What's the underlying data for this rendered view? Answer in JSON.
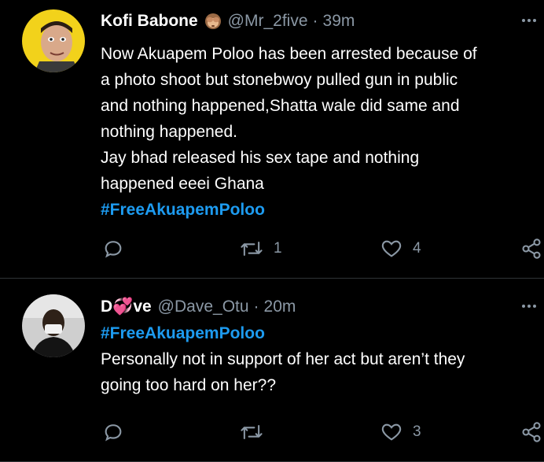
{
  "tweets": [
    {
      "author_name": "Kofi Babone",
      "author_emoji": "see-no-evil-monkey",
      "handle": "@Mr_2five",
      "separator": "·",
      "time": "39m",
      "lines": [
        "Now Akuapem Poloo has been arrested because of",
        "a photo shoot  but stonebwoy pulled gun in public",
        "and nothing happened,Shatta wale did same and",
        "nothing happened.",
        "Jay bhad released his sex tape and nothing",
        "happened eeei Ghana"
      ],
      "hashtag": "#FreeAkuapemPoloo",
      "retweets": "1",
      "likes": "4"
    },
    {
      "author_name": "D💞ve",
      "handle": "@Dave_Otu",
      "separator": "·",
      "time": "20m",
      "hashtag": "#FreeAkuapemPoloo",
      "lines": [
        "Personally not in support of her act but aren’t they",
        "going too hard on her??"
      ],
      "retweets": "",
      "likes": "3"
    }
  ],
  "icons": {
    "reply": "reply-icon",
    "retweet": "retweet-icon",
    "like": "heart-icon",
    "share": "share-icon",
    "more": "more-icon"
  },
  "colors": {
    "background": "#000000",
    "text": "#ffffff",
    "muted": "#8b98a5",
    "hashtag": "#1d9bf0",
    "divider": "#2f3336"
  }
}
